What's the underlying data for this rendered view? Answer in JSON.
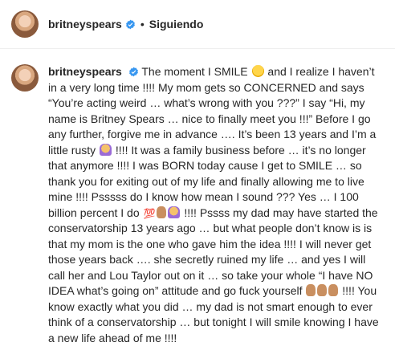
{
  "header": {
    "username": "britneyspears",
    "separator": "•",
    "follow_status": "Siguiendo"
  },
  "post": {
    "username": "britneyspears",
    "caption_parts": [
      " The moment I SMILE ",
      " and I realize I haven’t in a very long time !!!! My mom gets so CONCERNED and says “You’re acting weird … what’s wrong with you ???” I say “Hi, my name is Britney Spears … nice to finally meet you !!!” Before I go any further, forgive me in advance …. It’s been 13 years and I’m a little rusty ",
      " !!!! It was a family business before … it’s no longer that anymore !!!! I was BORN today cause I get to SMILE … so thank you for exiting out of my life and finally allowing me to live mine !!!! Psssss do I know how mean I sound ???  Yes … I 100 billion percent I do ",
      " !!!! Pssss my dad may have started the conservatorship 13 years ago … but what people don’t know is is that my mom is the one who gave him the idea !!!! I will never get those years back …. she secretly ruined my life … and yes I will call her and Lou Taylor out on it … so take your whole “I have NO IDEA what’s going on” attitude and go fuck yourself ",
      " !!!! You know exactly what you did … my dad is not smart enough to ever think of a conservatorship … but tonight I will smile knowing I have a new life ahead of me !!!!"
    ],
    "emoji_icons": [
      "grin-emoji-icon",
      "shrug-emoji-icon",
      "hundred-emoji-icon",
      "thumbs-up-emoji-icon",
      "shrug-emoji-icon",
      "thumbs-up-emoji-icon"
    ]
  },
  "colors": {
    "verified": "#3897f0",
    "text": "#262626",
    "divider": "#efefef"
  }
}
